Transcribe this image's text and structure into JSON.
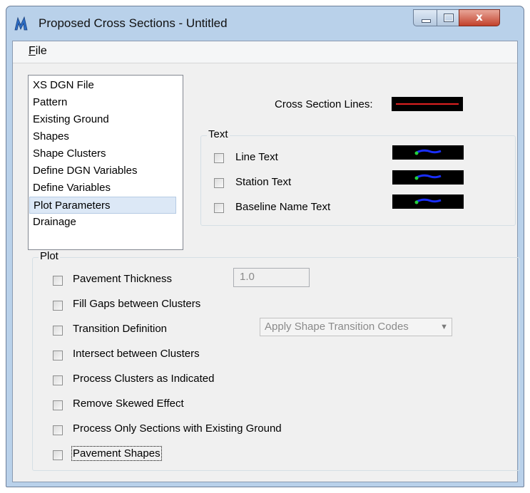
{
  "window": {
    "title": "Proposed Cross Sections - Untitled",
    "close_glyph": "x",
    "icons": {
      "app": "proposed-cross-sections-app-icon",
      "minimize": "minimize-icon",
      "maximize": "maximize-icon",
      "close": "close-icon"
    }
  },
  "menu": {
    "file_mnemonic": "F",
    "file_rest": "ile"
  },
  "list": {
    "items": [
      "XS DGN File",
      "Pattern",
      "Existing Ground",
      "Shapes",
      "Shape Clusters",
      "Define DGN Variables",
      "Define Variables",
      "Plot Parameters",
      "Drainage"
    ],
    "selected": "Plot Parameters"
  },
  "cross_section": {
    "label": "Cross Section Lines:",
    "line_color": "#e02020"
  },
  "text_group": {
    "label": "Text",
    "options": [
      {
        "label": "Line Text",
        "checked": false
      },
      {
        "label": "Station Text",
        "checked": false
      },
      {
        "label": "Baseline Name Text",
        "checked": false
      }
    ]
  },
  "plot_group": {
    "label": "Plot",
    "options": [
      {
        "label": "Pavement Thickness",
        "checked": false
      },
      {
        "label": "Fill Gaps between Clusters",
        "checked": false
      },
      {
        "label": "Transition Definition",
        "checked": false
      },
      {
        "label": "Intersect between Clusters",
        "checked": false
      },
      {
        "label": "Process Clusters as Indicated",
        "checked": false
      },
      {
        "label": "Remove Skewed Effect",
        "checked": false
      },
      {
        "label": "Process Only Sections with Existing Ground",
        "checked": false
      },
      {
        "label": "Pavement Shapes",
        "checked": false
      }
    ],
    "pavement_thickness_value": "1.0",
    "transition_select_value": "Apply Shape Transition Codes"
  },
  "colors": {
    "symbology_bg": "#000000",
    "text_symbol_blue": "#1a2fff",
    "text_symbol_green": "#22d03a"
  }
}
